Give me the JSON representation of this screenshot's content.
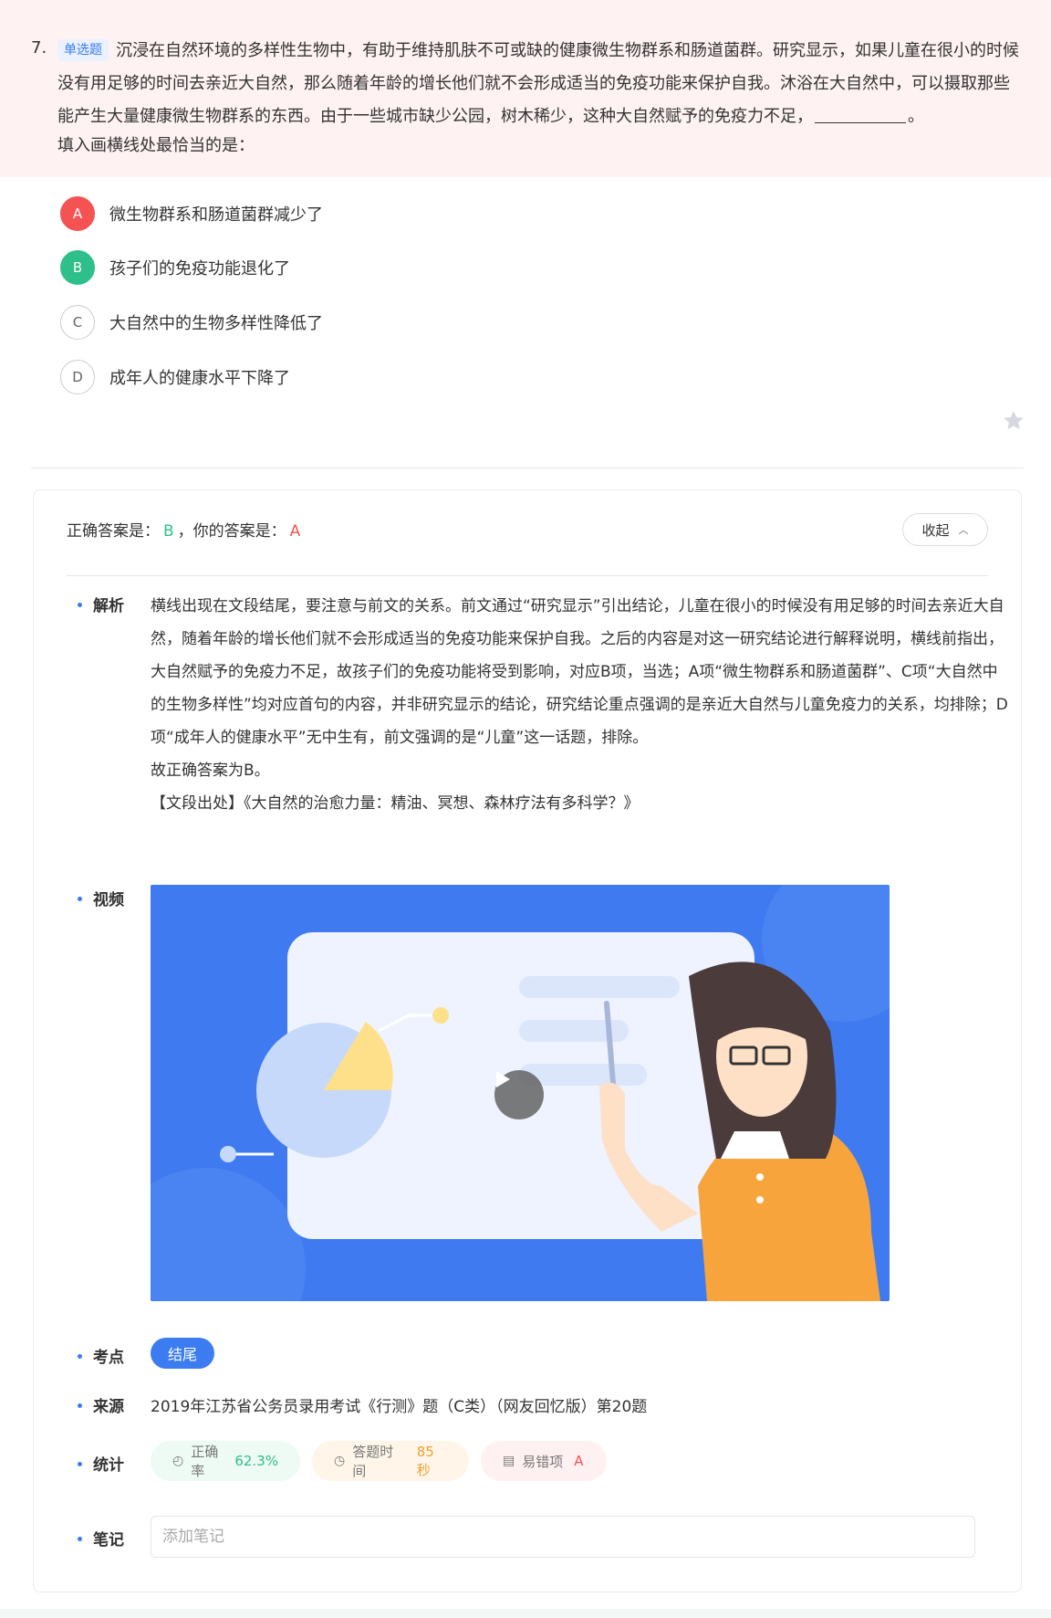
{
  "question": {
    "number": "7.",
    "type_tag": "单选题",
    "stem_part1": "沉浸在自然环境的多样性生物中，有助于维持肌肤不可或缺的健康微生物群系和肠道菌群。研究显示，如果儿童在很小的时候没有用足够的时间去亲近大自然，那么随着年龄的增长他们就不会形成适当的免疫功能来保护自我。沐浴在大自然中，可以摄取那些能产生大量健康微生物群系的东西。由于一些城市缺少公园，树木稀少，这种大自然赋予的免疫力不足，",
    "stem_part2": "。",
    "prompt": "填入画横线处最恰当的是："
  },
  "options": [
    {
      "letter": "A",
      "text": "微生物群系和肠道菌群减少了",
      "state": "wrong"
    },
    {
      "letter": "B",
      "text": "孩子们的免疫功能退化了",
      "state": "right"
    },
    {
      "letter": "C",
      "text": "大自然中的生物多样性降低了",
      "state": "none"
    },
    {
      "letter": "D",
      "text": "成年人的健康水平下降了",
      "state": "none"
    }
  ],
  "answer": {
    "correct_label": "正确答案是：",
    "correct_value": "B",
    "sep": "，你的答案是：",
    "mine_value": "A",
    "collapse_label": "收起"
  },
  "analysis": {
    "label": "解析",
    "paragraph": "横线出现在文段结尾，要注意与前文的关系。前文通过“研究显示”引出结论，儿童在很小的时候没有用足够的时间去亲近大自然，随着年龄的增长他们就不会形成适当的免疫功能来保护自我。之后的内容是对这一研究结论进行解释说明，横线前指出，大自然赋予的免疫力不足，故孩子们的免疫功能将受到影响，对应B项，当选；A项“微生物群系和肠道菌群”、C项“大自然中的生物多样性”均对应首句的内容，并非研究显示的结论，研究结论重点强调的是亲近大自然与儿童免疫力的关系，均排除；D项“成年人的健康水平”无中生有，前文强调的是“儿童”这一话题，排除。",
    "conclusion": "故正确答案为B。",
    "source_note": "【文段出处】《大自然的治愈力量：精油、冥想、森林疗法有多科学？》"
  },
  "video": {
    "label": "视频"
  },
  "knowledge": {
    "label": "考点",
    "tag": "结尾"
  },
  "source": {
    "label": "来源",
    "text": "2019年江苏省公务员录用考试《行测》题（C类）（网友回忆版）第20题"
  },
  "stats": {
    "label": "统计",
    "accuracy_label": "正确率",
    "accuracy_value": "62.3%",
    "time_label": "答题时间",
    "time_value": "85秒",
    "error_label": "易错项",
    "error_value": "A"
  },
  "notes": {
    "label": "笔记",
    "placeholder": "添加笔记"
  },
  "colors": {
    "wrong": "#f55353",
    "right": "#2fbf8a",
    "accent": "#3b7cf0",
    "header_bg": "#fff2f2"
  }
}
